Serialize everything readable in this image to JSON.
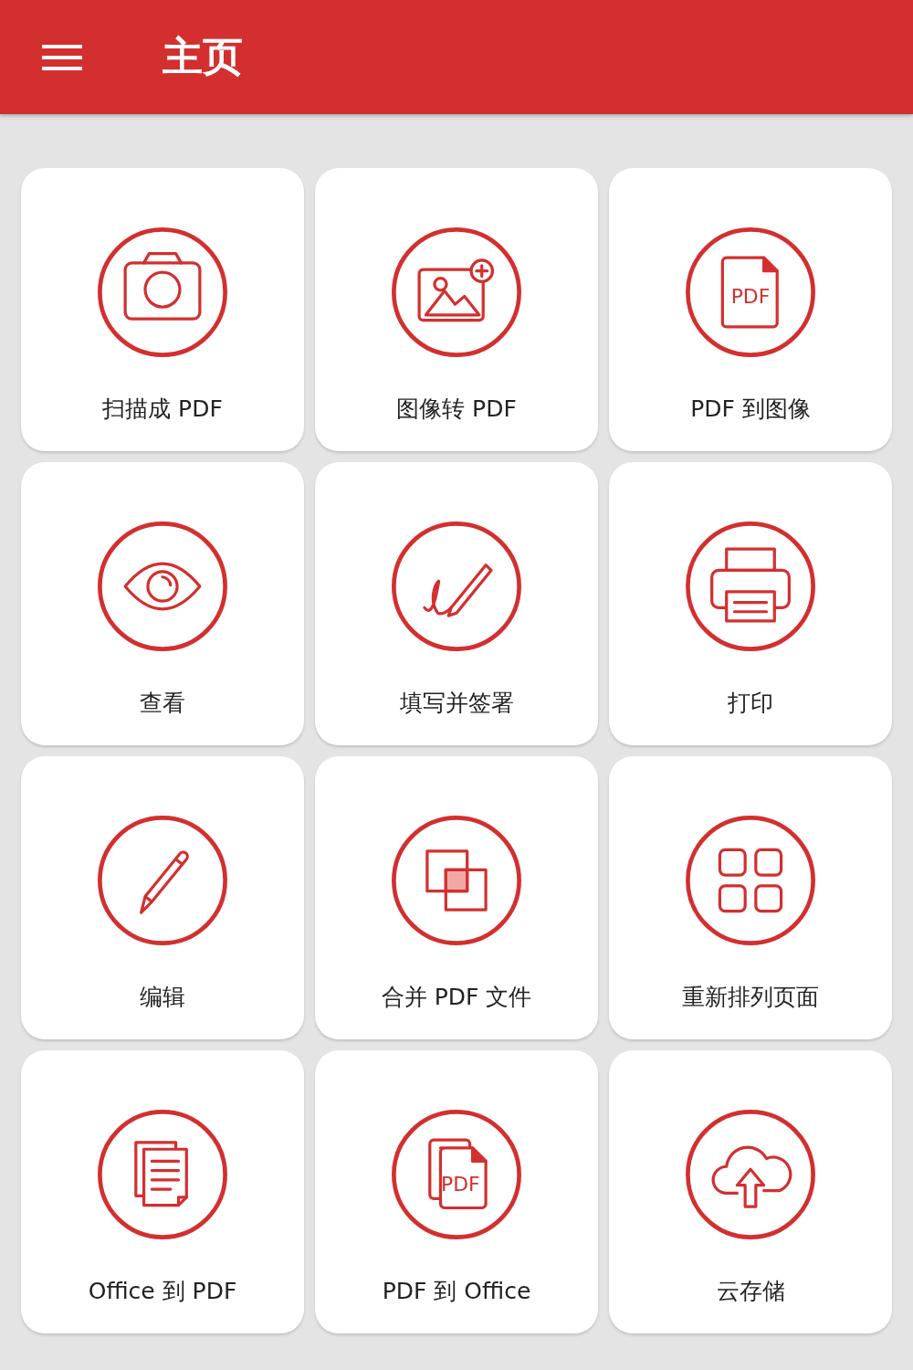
{
  "header": {
    "title": "主页"
  },
  "tiles": [
    {
      "label": "扫描成 PDF",
      "kind": "camera"
    },
    {
      "label": "图像转 PDF",
      "kind": "image"
    },
    {
      "label": "PDF 到图像",
      "kind": "pdf",
      "icon_text": "PDF"
    },
    {
      "label": "查看",
      "kind": "eye"
    },
    {
      "label": "填写并签署",
      "kind": "signature"
    },
    {
      "label": "打印",
      "kind": "printer"
    },
    {
      "label": "编辑",
      "kind": "pencil"
    },
    {
      "label": "合并 PDF 文件",
      "kind": "merge"
    },
    {
      "label": "重新排列页面",
      "kind": "grid"
    },
    {
      "label": "Office 到 PDF",
      "kind": "documents"
    },
    {
      "label": "PDF 到 Office",
      "kind": "pdfs",
      "icon_text": "PDF"
    },
    {
      "label": "云存储",
      "kind": "cloud"
    }
  ]
}
